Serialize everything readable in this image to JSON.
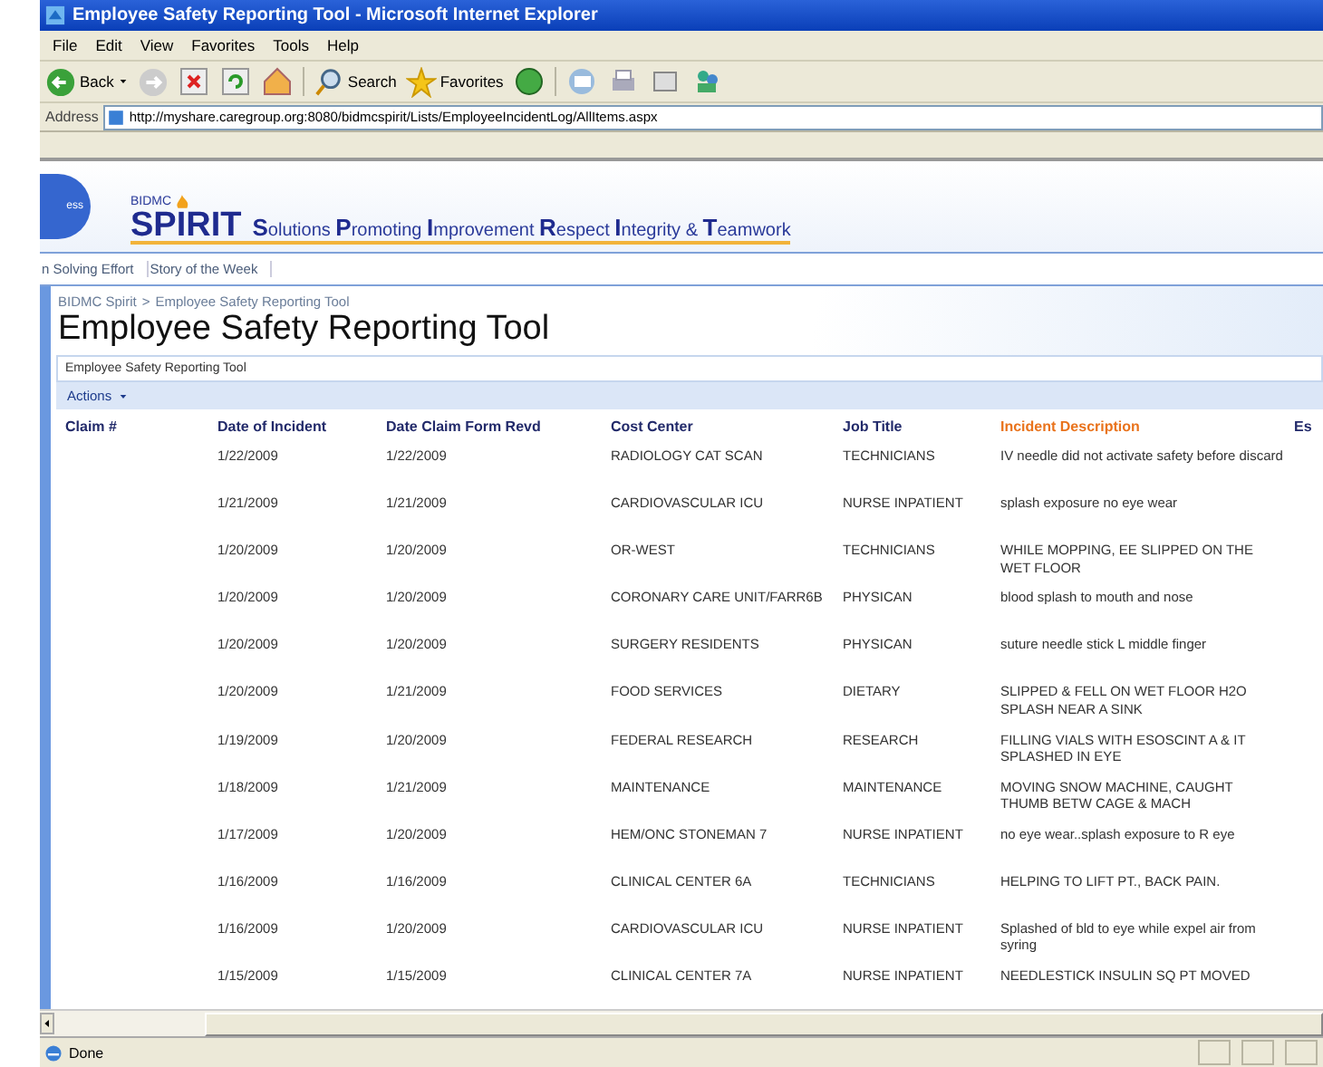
{
  "window": {
    "title": "Employee Safety Reporting Tool - Microsoft Internet Explorer"
  },
  "menu": [
    "File",
    "Edit",
    "View",
    "Favorites",
    "Tools",
    "Help"
  ],
  "toolbar": {
    "back": "Back",
    "search": "Search",
    "favorites": "Favorites"
  },
  "address": {
    "label": "Address",
    "url": "http://myshare.caregroup.org:8080/bidmcspirit/Lists/EmployeeIncidentLog/AllItems.aspx"
  },
  "banner": {
    "badge": "ess",
    "logo_small": "BIDMC",
    "logo": "SPIRIT",
    "tagline": "**S**olutions **P**romoting **I**mprovement **R**espect **I**ntegrity & **T**eamwork"
  },
  "nav": [
    "n Solving Effort",
    "Story of the Week"
  ],
  "breadcrumb": [
    "BIDMC Spirit",
    ">",
    "Employee Safety Reporting Tool"
  ],
  "page_title": "Employee Safety Reporting Tool",
  "webpart_title": "Employee Safety Reporting Tool",
  "actions": "Actions",
  "table": {
    "columns": [
      {
        "label": "Claim #",
        "sorted": false
      },
      {
        "label": "Date of Incident",
        "sorted": false
      },
      {
        "label": "Date Claim Form Revd",
        "sorted": false
      },
      {
        "label": "Cost Center",
        "sorted": false
      },
      {
        "label": "Job Title",
        "sorted": false
      },
      {
        "label": "Incident Description",
        "sorted": true
      },
      {
        "label": "Es",
        "sorted": false
      }
    ],
    "rows": [
      {
        "date_of_incident": "1/22/2009",
        "date_received": "1/22/2009",
        "cost_center": "RADIOLOGY CAT SCAN",
        "job_title": "TECHNICIANS",
        "description": "IV needle did not activate safety before discard"
      },
      {
        "date_of_incident": "1/21/2009",
        "date_received": "1/21/2009",
        "cost_center": "CARDIOVASCULAR ICU",
        "job_title": "NURSE INPATIENT",
        "description": "splash exposure no eye wear"
      },
      {
        "date_of_incident": "1/20/2009",
        "date_received": "1/20/2009",
        "cost_center": "OR-WEST",
        "job_title": "TECHNICIANS",
        "description": "WHILE MOPPING, EE SLIPPED ON THE WET FLOOR"
      },
      {
        "date_of_incident": "1/20/2009",
        "date_received": "1/20/2009",
        "cost_center": "CORONARY CARE UNIT/FARR6B",
        "job_title": "PHYSICAN",
        "description": "blood splash to mouth and nose"
      },
      {
        "date_of_incident": "1/20/2009",
        "date_received": "1/20/2009",
        "cost_center": "SURGERY RESIDENTS",
        "job_title": "PHYSICAN",
        "description": "suture needle stick L middle finger"
      },
      {
        "date_of_incident": "1/20/2009",
        "date_received": "1/21/2009",
        "cost_center": "FOOD SERVICES",
        "job_title": "DIETARY",
        "description": "SLIPPED & FELL ON WET FLOOR H2O SPLASH NEAR A SINK"
      },
      {
        "date_of_incident": "1/19/2009",
        "date_received": "1/20/2009",
        "cost_center": "FEDERAL RESEARCH",
        "job_title": "RESEARCH",
        "description": "FILLING VIALS WITH ESOSCINT A & IT SPLASHED IN EYE"
      },
      {
        "date_of_incident": "1/18/2009",
        "date_received": "1/21/2009",
        "cost_center": "MAINTENANCE",
        "job_title": "MAINTENANCE",
        "description": "MOVING SNOW MACHINE, CAUGHT THUMB BETW CAGE & MACH"
      },
      {
        "date_of_incident": "1/17/2009",
        "date_received": "1/20/2009",
        "cost_center": "HEM/ONC STONEMAN 7",
        "job_title": "NURSE INPATIENT",
        "description": "no eye wear..splash exposure to R eye"
      },
      {
        "date_of_incident": "1/16/2009",
        "date_received": "1/16/2009",
        "cost_center": "CLINICAL CENTER 6A",
        "job_title": "TECHNICIANS",
        "description": "HELPING TO LIFT PT., BACK PAIN."
      },
      {
        "date_of_incident": "1/16/2009",
        "date_received": "1/20/2009",
        "cost_center": "CARDIOVASCULAR ICU",
        "job_title": "NURSE INPATIENT",
        "description": "Splashed of bld to eye while expel air from syring"
      },
      {
        "date_of_incident": "1/15/2009",
        "date_received": "1/15/2009",
        "cost_center": "CLINICAL CENTER 7A",
        "job_title": "NURSE INPATIENT",
        "description": "NEEDLESTICK INSULIN SQ PT MOVED"
      }
    ]
  },
  "status_bar": {
    "text": "Done"
  }
}
